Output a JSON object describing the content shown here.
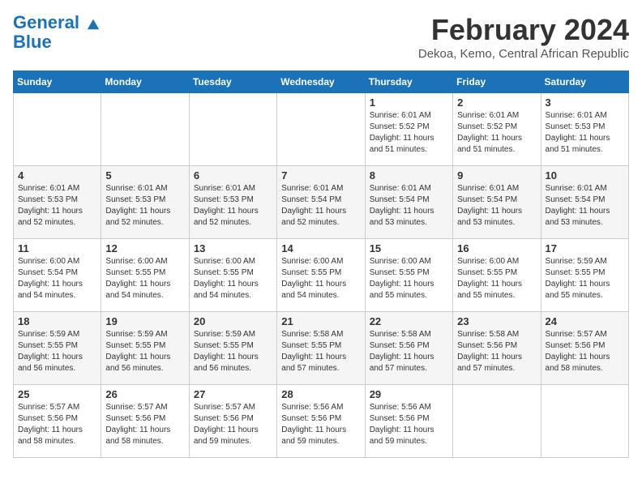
{
  "logo": {
    "line1": "General",
    "line2": "Blue"
  },
  "title": "February 2024",
  "subtitle": "Dekoa, Kemo, Central African Republic",
  "days_of_week": [
    "Sunday",
    "Monday",
    "Tuesday",
    "Wednesday",
    "Thursday",
    "Friday",
    "Saturday"
  ],
  "weeks": [
    [
      {
        "day": "",
        "info": ""
      },
      {
        "day": "",
        "info": ""
      },
      {
        "day": "",
        "info": ""
      },
      {
        "day": "",
        "info": ""
      },
      {
        "day": "1",
        "info": "Sunrise: 6:01 AM\nSunset: 5:52 PM\nDaylight: 11 hours\nand 51 minutes."
      },
      {
        "day": "2",
        "info": "Sunrise: 6:01 AM\nSunset: 5:52 PM\nDaylight: 11 hours\nand 51 minutes."
      },
      {
        "day": "3",
        "info": "Sunrise: 6:01 AM\nSunset: 5:53 PM\nDaylight: 11 hours\nand 51 minutes."
      }
    ],
    [
      {
        "day": "4",
        "info": "Sunrise: 6:01 AM\nSunset: 5:53 PM\nDaylight: 11 hours\nand 52 minutes."
      },
      {
        "day": "5",
        "info": "Sunrise: 6:01 AM\nSunset: 5:53 PM\nDaylight: 11 hours\nand 52 minutes."
      },
      {
        "day": "6",
        "info": "Sunrise: 6:01 AM\nSunset: 5:53 PM\nDaylight: 11 hours\nand 52 minutes."
      },
      {
        "day": "7",
        "info": "Sunrise: 6:01 AM\nSunset: 5:54 PM\nDaylight: 11 hours\nand 52 minutes."
      },
      {
        "day": "8",
        "info": "Sunrise: 6:01 AM\nSunset: 5:54 PM\nDaylight: 11 hours\nand 53 minutes."
      },
      {
        "day": "9",
        "info": "Sunrise: 6:01 AM\nSunset: 5:54 PM\nDaylight: 11 hours\nand 53 minutes."
      },
      {
        "day": "10",
        "info": "Sunrise: 6:01 AM\nSunset: 5:54 PM\nDaylight: 11 hours\nand 53 minutes."
      }
    ],
    [
      {
        "day": "11",
        "info": "Sunrise: 6:00 AM\nSunset: 5:54 PM\nDaylight: 11 hours\nand 54 minutes."
      },
      {
        "day": "12",
        "info": "Sunrise: 6:00 AM\nSunset: 5:55 PM\nDaylight: 11 hours\nand 54 minutes."
      },
      {
        "day": "13",
        "info": "Sunrise: 6:00 AM\nSunset: 5:55 PM\nDaylight: 11 hours\nand 54 minutes."
      },
      {
        "day": "14",
        "info": "Sunrise: 6:00 AM\nSunset: 5:55 PM\nDaylight: 11 hours\nand 54 minutes."
      },
      {
        "day": "15",
        "info": "Sunrise: 6:00 AM\nSunset: 5:55 PM\nDaylight: 11 hours\nand 55 minutes."
      },
      {
        "day": "16",
        "info": "Sunrise: 6:00 AM\nSunset: 5:55 PM\nDaylight: 11 hours\nand 55 minutes."
      },
      {
        "day": "17",
        "info": "Sunrise: 5:59 AM\nSunset: 5:55 PM\nDaylight: 11 hours\nand 55 minutes."
      }
    ],
    [
      {
        "day": "18",
        "info": "Sunrise: 5:59 AM\nSunset: 5:55 PM\nDaylight: 11 hours\nand 56 minutes."
      },
      {
        "day": "19",
        "info": "Sunrise: 5:59 AM\nSunset: 5:55 PM\nDaylight: 11 hours\nand 56 minutes."
      },
      {
        "day": "20",
        "info": "Sunrise: 5:59 AM\nSunset: 5:55 PM\nDaylight: 11 hours\nand 56 minutes."
      },
      {
        "day": "21",
        "info": "Sunrise: 5:58 AM\nSunset: 5:55 PM\nDaylight: 11 hours\nand 57 minutes."
      },
      {
        "day": "22",
        "info": "Sunrise: 5:58 AM\nSunset: 5:56 PM\nDaylight: 11 hours\nand 57 minutes."
      },
      {
        "day": "23",
        "info": "Sunrise: 5:58 AM\nSunset: 5:56 PM\nDaylight: 11 hours\nand 57 minutes."
      },
      {
        "day": "24",
        "info": "Sunrise: 5:57 AM\nSunset: 5:56 PM\nDaylight: 11 hours\nand 58 minutes."
      }
    ],
    [
      {
        "day": "25",
        "info": "Sunrise: 5:57 AM\nSunset: 5:56 PM\nDaylight: 11 hours\nand 58 minutes."
      },
      {
        "day": "26",
        "info": "Sunrise: 5:57 AM\nSunset: 5:56 PM\nDaylight: 11 hours\nand 58 minutes."
      },
      {
        "day": "27",
        "info": "Sunrise: 5:57 AM\nSunset: 5:56 PM\nDaylight: 11 hours\nand 59 minutes."
      },
      {
        "day": "28",
        "info": "Sunrise: 5:56 AM\nSunset: 5:56 PM\nDaylight: 11 hours\nand 59 minutes."
      },
      {
        "day": "29",
        "info": "Sunrise: 5:56 AM\nSunset: 5:56 PM\nDaylight: 11 hours\nand 59 minutes."
      },
      {
        "day": "",
        "info": ""
      },
      {
        "day": "",
        "info": ""
      }
    ]
  ]
}
